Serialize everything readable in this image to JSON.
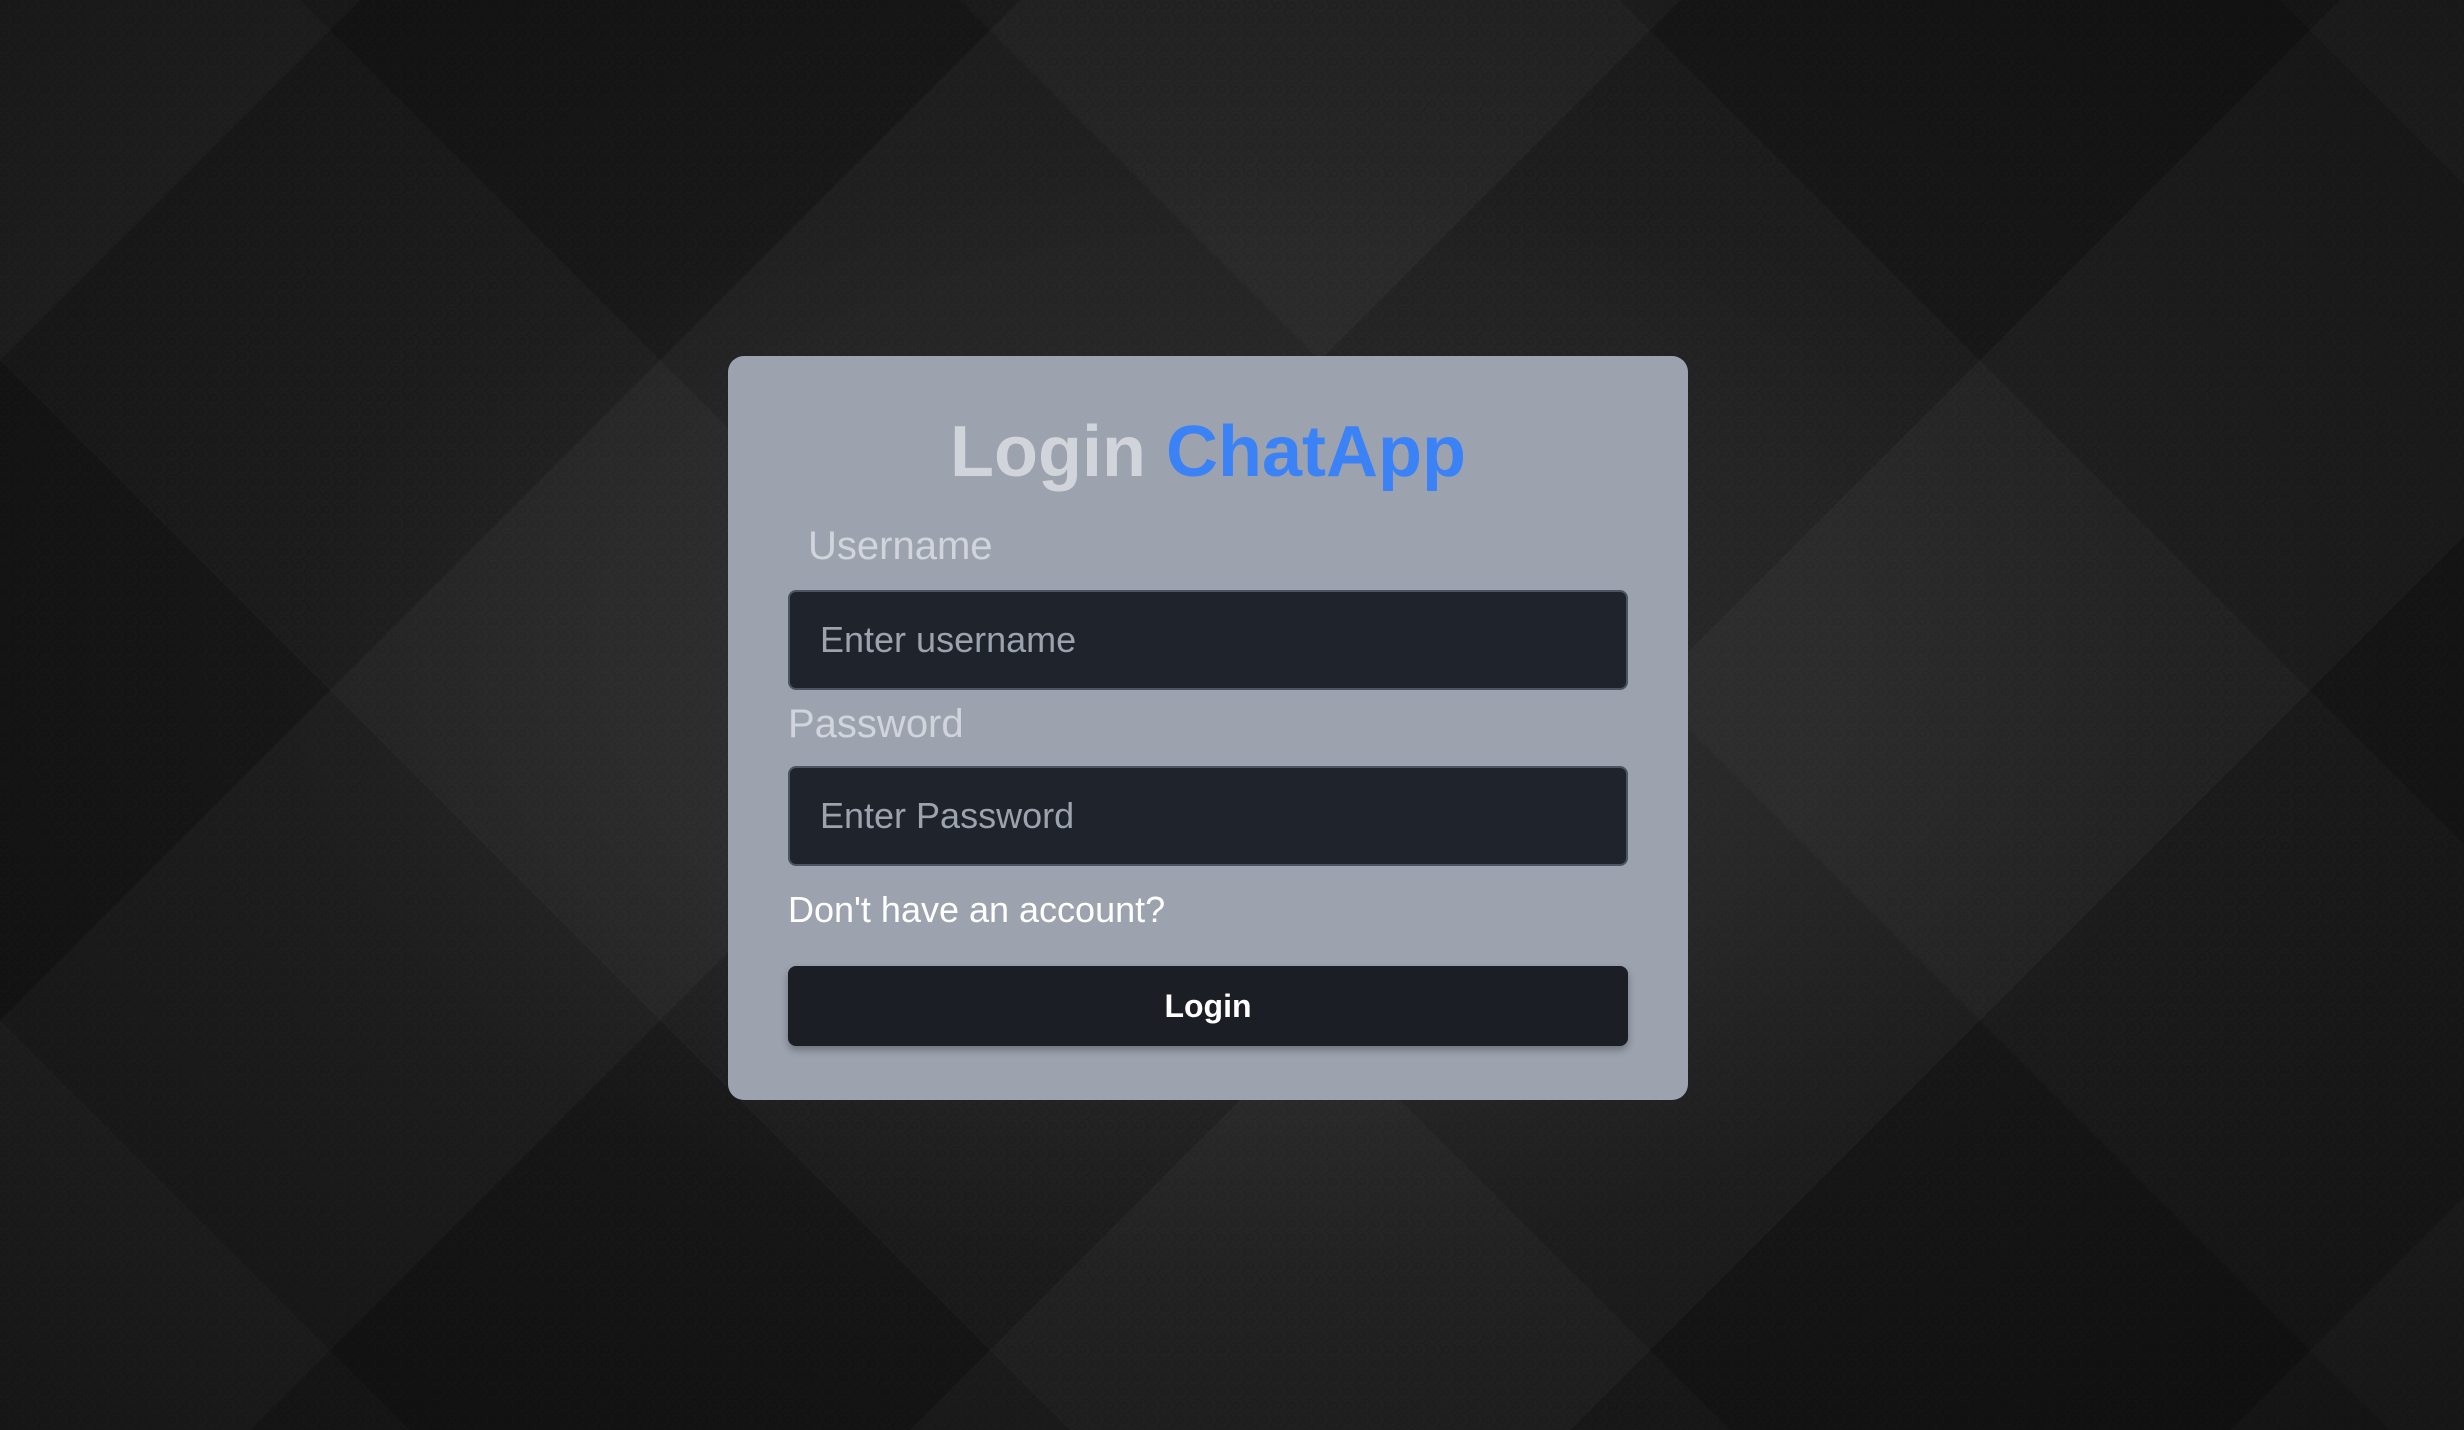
{
  "login_form": {
    "title_prefix": "Login",
    "title_brand": "ChatApp",
    "username": {
      "label": "Username",
      "placeholder": "Enter username",
      "value": ""
    },
    "password": {
      "label": "Password",
      "placeholder": "Enter Password",
      "value": ""
    },
    "signup_link": "Don't have an account?",
    "submit_label": "Login"
  },
  "colors": {
    "card_background": "#9ca3af",
    "brand_accent": "#3b82f6",
    "input_background": "#1f232b",
    "button_background": "#1b1e25"
  }
}
